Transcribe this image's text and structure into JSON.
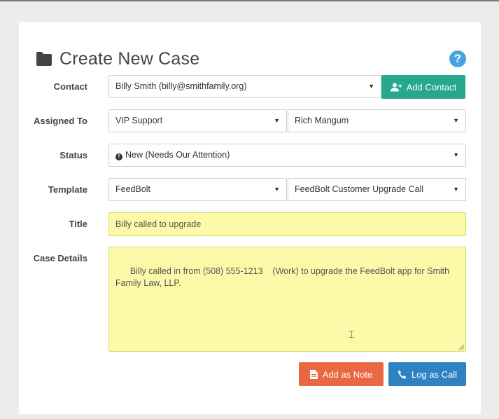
{
  "page": {
    "title": "Create New Case",
    "help_icon_label": "?"
  },
  "form": {
    "contact": {
      "label": "Contact",
      "value": "Billy Smith (billy@smithfamily.org)",
      "add_contact_label": "Add Contact"
    },
    "assigned_to": {
      "label": "Assigned To",
      "team_value": "VIP Support",
      "user_value": "Rich Mangum"
    },
    "status": {
      "label": "Status",
      "value": "New (Needs Our Attention)",
      "icon_glyph": "!"
    },
    "template": {
      "label": "Template",
      "app_value": "FeedBolt",
      "template_value": "FeedBolt Customer Upgrade Call"
    },
    "title": {
      "label": "Title",
      "value": "Billy called to upgrade"
    },
    "details": {
      "label": "Case Details",
      "value": "Billy called in from (508) 555-1213    (Work) to upgrade the FeedBolt app for Smith Family Law, LLP."
    }
  },
  "actions": {
    "add_note_label": "Add as Note",
    "log_call_label": "Log as Call"
  },
  "colors": {
    "teal": "#25a88c",
    "orange": "#ea6743",
    "blue": "#2f82c1",
    "highlight": "#fcfaa8",
    "help": "#4aa3df"
  }
}
